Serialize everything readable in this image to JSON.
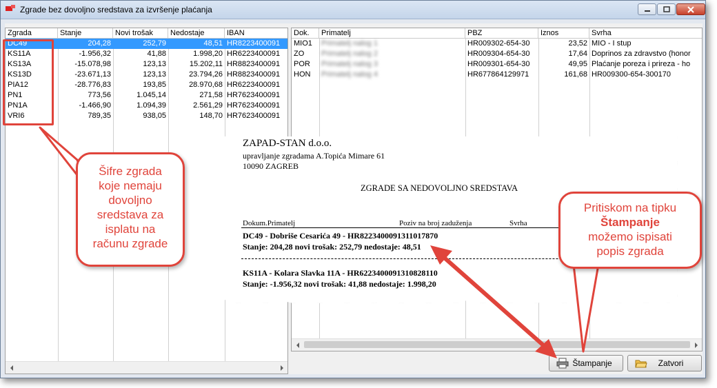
{
  "window": {
    "title": "Zgrade bez dovoljno sredstava za izvršenje plaćanja"
  },
  "colors": {
    "selection": "#3399ff",
    "annotation": "#e0443b"
  },
  "left_grid": {
    "headers": [
      "Zgrada",
      "Stanje",
      "Novi trošak",
      "Nedostaje",
      "IBAN"
    ],
    "rows": [
      {
        "zgrada": "DC49",
        "stanje": "204,28",
        "novi": "252,79",
        "nedostaje": "48,51",
        "iban": "HR8223400091"
      },
      {
        "zgrada": "KS11A",
        "stanje": "-1.956,32",
        "novi": "41,88",
        "nedostaje": "1.998,20",
        "iban": "HR6223400091"
      },
      {
        "zgrada": "KS13A",
        "stanje": "-15.078,98",
        "novi": "123,13",
        "nedostaje": "15.202,11",
        "iban": "HR8823400091"
      },
      {
        "zgrada": "KS13D",
        "stanje": "-23.671,13",
        "novi": "123,13",
        "nedostaje": "23.794,26",
        "iban": "HR8823400091"
      },
      {
        "zgrada": "PIA12",
        "stanje": "-28.776,83",
        "novi": "193,85",
        "nedostaje": "28.970,68",
        "iban": "HR6223400091"
      },
      {
        "zgrada": "PN1",
        "stanje": "773,56",
        "novi": "1.045,14",
        "nedostaje": "271,58",
        "iban": "HR7623400091"
      },
      {
        "zgrada": "PN1A",
        "stanje": "-1.466,90",
        "novi": "1.094,39",
        "nedostaje": "2.561,29",
        "iban": "HR7623400091"
      },
      {
        "zgrada": "VRI6",
        "stanje": "789,35",
        "novi": "938,05",
        "nedostaje": "148,70",
        "iban": "HR7623400091"
      }
    ]
  },
  "right_grid": {
    "headers": [
      "Dok.",
      "Primatelj",
      "PBZ",
      "Iznos",
      "Svrha"
    ],
    "rows": [
      {
        "dok": "MIO1",
        "primatelj": "Primatelj nalog 1",
        "pbz": "HR009302-654-30",
        "iznos": "23,52",
        "svrha": "MIO - I stup"
      },
      {
        "dok": "ZO",
        "primatelj": "Primatelj nalog 2",
        "pbz": "HR009304-654-30",
        "iznos": "17,64",
        "svrha": "Doprinos za zdravstvo (honor"
      },
      {
        "dok": "POR",
        "primatelj": "Primatelj nalog 3",
        "pbz": "HR009301-654-30",
        "iznos": "49,95",
        "svrha": "Plaćanje poreza i prireza - ho"
      },
      {
        "dok": "HON",
        "primatelj": "Primatelj nalog 4",
        "pbz": "HR677864129971",
        "iznos": "161,68",
        "svrha": "HR009300-654-300170"
      }
    ]
  },
  "report": {
    "company": "ZAPAD-STAN d.o.o.",
    "line2": "upravljanje zgradama A.Topića Mimare 61",
    "line3": "10090 ZAGREB",
    "heading": "ZGRADE SA NEDOVOLJNO SREDSTAVA",
    "col1": "Dokum.Primatelj",
    "col2": "Poziv na broj zaduženja",
    "col3": "Svrha",
    "entry1_title": "DC49 - Dobriše Cesarića 49 - HR8223400091311017870",
    "entry1_values": "Stanje: 204,28  novi trošak: 252,79  nedostaje: 48,51",
    "entry2_title": "KS11A - Kolara Slavka 11A - HR6223400091310828110",
    "entry2_values": "Stanje: -1.956,32  novi trošak: 41,88  nedostaje: 1.998,20"
  },
  "buttons": {
    "print": "Štampanje",
    "close": "Zatvori"
  },
  "callouts": {
    "left": [
      "Šifre zgrada",
      "koje nemaju",
      "dovoljno",
      "sredstava za",
      "isplatu na",
      "računu zgrade"
    ],
    "right_1": "Pritiskom na tipku",
    "right_bold": "Štampanje",
    "right_2": [
      "možemo ispisati",
      "popis zgrada"
    ]
  }
}
